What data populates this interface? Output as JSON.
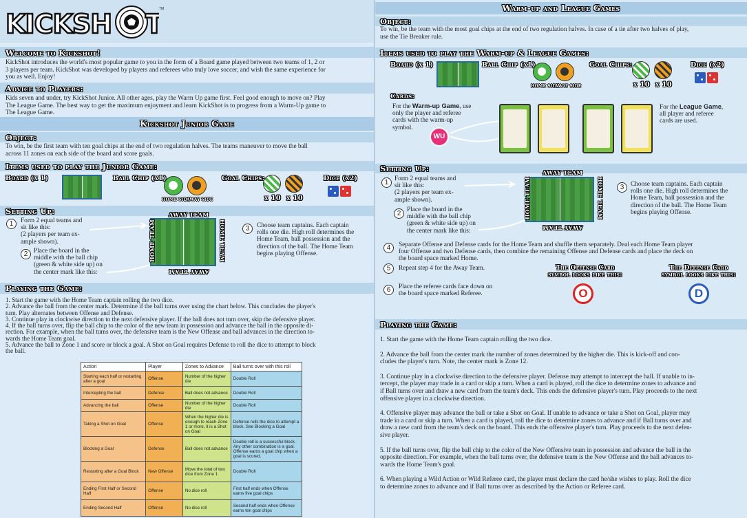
{
  "left": {
    "logo": "KICKSHOT",
    "tm": "TM",
    "welcome_h": "Welcome to Kickshot!",
    "welcome": [
      "KickShot introduces the world's most popular game to you in the form of a Board game played between two teams of 1, 2 or",
      "3 players per team. KickShot was developed by players and referees who truly love soccer, and wish the same experience for",
      "you as well. Enjoy!"
    ],
    "advice_h": "Advice to Players:",
    "advice": [
      "Kids seven and under, try KickShot Junior. All other ages, play the Warm Up game first. Feel good enough to move on? Play",
      "The League Game.  The best way to get the maximum enjoyment and learn KickShot is to progress from a Warm-Up game to",
      "The League Game."
    ],
    "junior_h": "Kickshot Junior Game",
    "object_h": "Object:",
    "object": [
      "To win, be the first team with ten goal chips at the end of two regulation halves. The teams maneuver to move the ball",
      "across 11 zones on each side of the board and score goals."
    ],
    "items_h": "Items used to play the Junior Game:",
    "board_l": "Board (x 1)",
    "ball_l": "Ball Chip (x1)",
    "home_side": "HOME SIDE",
    "away_side": "AWAY SIDE",
    "goal_l": "Goal Chips:",
    "x10": "x 10",
    "dice_l": "Dice (x2)",
    "setup_h": "Setting Up:",
    "s1": [
      "Form 2 equal teams and",
      "sit like this:",
      "(2 players per team ex-",
      "ample shown)."
    ],
    "s2": [
      "Place the board in the",
      "middle with the ball chip",
      "(green & white side up) on",
      "the center mark like this:"
    ],
    "s3": [
      "Choose team captains. Each captain",
      "rolls one die. High roll determines the",
      "Home Team, ball possession and the",
      "direction of the ball. The Home Team",
      "begins playing Offense."
    ],
    "n1": "1",
    "n2": "2",
    "n3": "3",
    "away_team": "AWAY TEAM",
    "home_team": "HOME TEAM",
    "playing_h": "Playing the Game:",
    "play": [
      "1.   Start the game with the Home Team captain rolling the two dice.",
      "2.   Advance the ball from the center mark. Determine if the ball turns over using the chart below. This concludes the player's",
      "turn. Play alternates between Offense and Defense.",
      "3.   Continue play in clockwise direction to the next defensive player. If the ball does not turn over, skip the defensive player.",
      "4.   If the ball turns over, flip the ball chip to the color of the new team in possession and advance the ball in the opposite di-",
      "rection. For example, when the ball turns over, the defensive team is the New Offense and ball advances in the direction to-",
      "wards the Home Team goal.",
      "5.   Advance the ball to Zone 1 and score or block a goal. A Shot on Goal requires Defense to roll the dice to attempt to block",
      "the ball."
    ],
    "table_head": [
      "Action",
      "Player",
      "Zones to Advance",
      "Ball turns over with this roll"
    ],
    "table_rows": [
      [
        "Starting each half or restarting after a goal",
        "Offense",
        "Number of the higher die",
        "Double Roll"
      ],
      [
        "Intercepting the ball",
        "Defense",
        "Ball does not advance",
        "Double Roll"
      ],
      [
        "Advancing the ball",
        "Offense",
        "Number of the higher die",
        "Double Roll"
      ],
      [
        "Taking a Shot on Goal",
        "Offense",
        "When the higher die is enough to reach Zone 1 or more, it is a Shot on Goal",
        "Defense rolls the dice to attempt a block.  See Blocking a Goal"
      ],
      [
        "Blocking a Goal",
        "Defense",
        "Ball does not advance",
        "Double roll is a successful block.  Any other combination is a goal.  Offense earns a goal chip when a goal is scored."
      ],
      [
        "Restarting after a Goal Block",
        "New Offense",
        "Move the total of two dice from Zone 1",
        "Double Roll"
      ],
      [
        "Ending First Half or Second Half",
        "Offense",
        "No dice roll",
        "First half ends when Offense earns five goal chips"
      ],
      [
        "Ending Second Half",
        "Offense",
        "No dice roll",
        "Second half ends when Offense earns ten goal chips"
      ]
    ]
  },
  "right": {
    "title": "Warm-up and League Games",
    "object_h": "Object:",
    "object": [
      "To win, be the team with the most goal chips at the end of two regulation halves. In case of a tie after two halves of play,",
      "use the Tie Breaker rule."
    ],
    "items_h": "Items used to play the Warm-up & League Games:",
    "board_l": "Board (x 1)",
    "ball_l": "Ball Chip (x1)",
    "home_side": "HOME SIDE",
    "away_side": "AWAY SIDE",
    "goal_l": "Goal Chips:",
    "x10a": "x 10",
    "x10b": "x 10",
    "dice_l": "Dice (x2)",
    "cards_h": "Cards:",
    "warm": [
      "For the ",
      "Warm-up Game",
      ", use",
      "only the player and referee",
      "cards with the warm-up",
      "symbol."
    ],
    "wu": "WU",
    "league": [
      "For the ",
      "League Game",
      ",",
      "all player and referee",
      "cards are used."
    ],
    "setup_h": "Setting Up:",
    "s1": [
      "Form 2 equal teams and",
      "sit like this:",
      "(2 players per team ex-",
      "ample shown)."
    ],
    "s2": [
      "Place the board in the",
      "middle with the ball chip",
      "(green & white side up) on",
      "the center mark like this:"
    ],
    "s3": [
      "Choose team captains. Each captain",
      "rolls one die. High roll determines the",
      "Home Team, ball possession and the",
      "direction of the ball. The Home Team",
      "begins playing Offense."
    ],
    "s4": [
      "Separate Offense and Defense cards for the Home Team and shuffle them separately. Deal each Home Team player",
      "four Offense and two Defense cards, then combine the remaining Offense and Defense cards and place the deck on",
      "the board space marked Home."
    ],
    "s5": "Repeat step 4 for the Away Team.",
    "s6": [
      "Place the referee cards face down on",
      "the board space marked Referee."
    ],
    "n1": "1",
    "n2": "2",
    "n3": "3",
    "n4": "4",
    "n5": "5",
    "n6": "6",
    "away_team": "AWAY TEAM",
    "home_team": "HOME TEAM",
    "off_h": [
      "The Offense Card",
      "symbol looks like this:"
    ],
    "off_sym": "O",
    "def_h": [
      "The Defense Card",
      "symbol looks like this:"
    ],
    "def_sym": "D",
    "playing_h": "Playing the Game:",
    "play": [
      [
        "1.   Start the game with the Home Team captain rolling the two dice."
      ],
      [
        "2.   Advance the ball from the center mark the number of zones determined by the higher die. This is kick-off and con-",
        "cludes the player's turn. Note, the center mark is Zone 12."
      ],
      [
        "3.   Continue play in a clockwise direction to the defensive player. Defense may attempt to intercept the ball. If unable to in-",
        "tercept, the player may trade in a card or skip a turn. When a card is played, roll the dice to determine zones to advance and",
        "if Ball turns over and draw a new card from the team's deck. This ends the defensive player's turn. Play proceeds to the next",
        "offensive player in a clockwise direction."
      ],
      [
        "4.   Offensive player may advance the ball or take a Shot on Goal. If unable to advance or take a Shot on Goal, player may",
        "trade in a card or skip a turn. When a card is played, roll the dice to determine zones to advance and if Ball turns over and",
        "draw a new card from the team's deck on the board. This ends the offensive player's turn. Play proceeds to the next defen-",
        "sive player."
      ],
      [
        "5.   If the ball turns over, flip the ball chip to the color of the New Offensive team in possession and advance the ball in the",
        "opposite direction. For example, when the ball turns over, the defensive team is the New Offense and the ball advances to-",
        "wards the Home Team's goal."
      ],
      [
        "6.   When playing a Wild Action or Wild Referee card, the player must declare the card he/she wishes to play. Roll the dice",
        "to determine zones to advance and if Ball turns over as described by the Action or Referee card."
      ]
    ]
  }
}
